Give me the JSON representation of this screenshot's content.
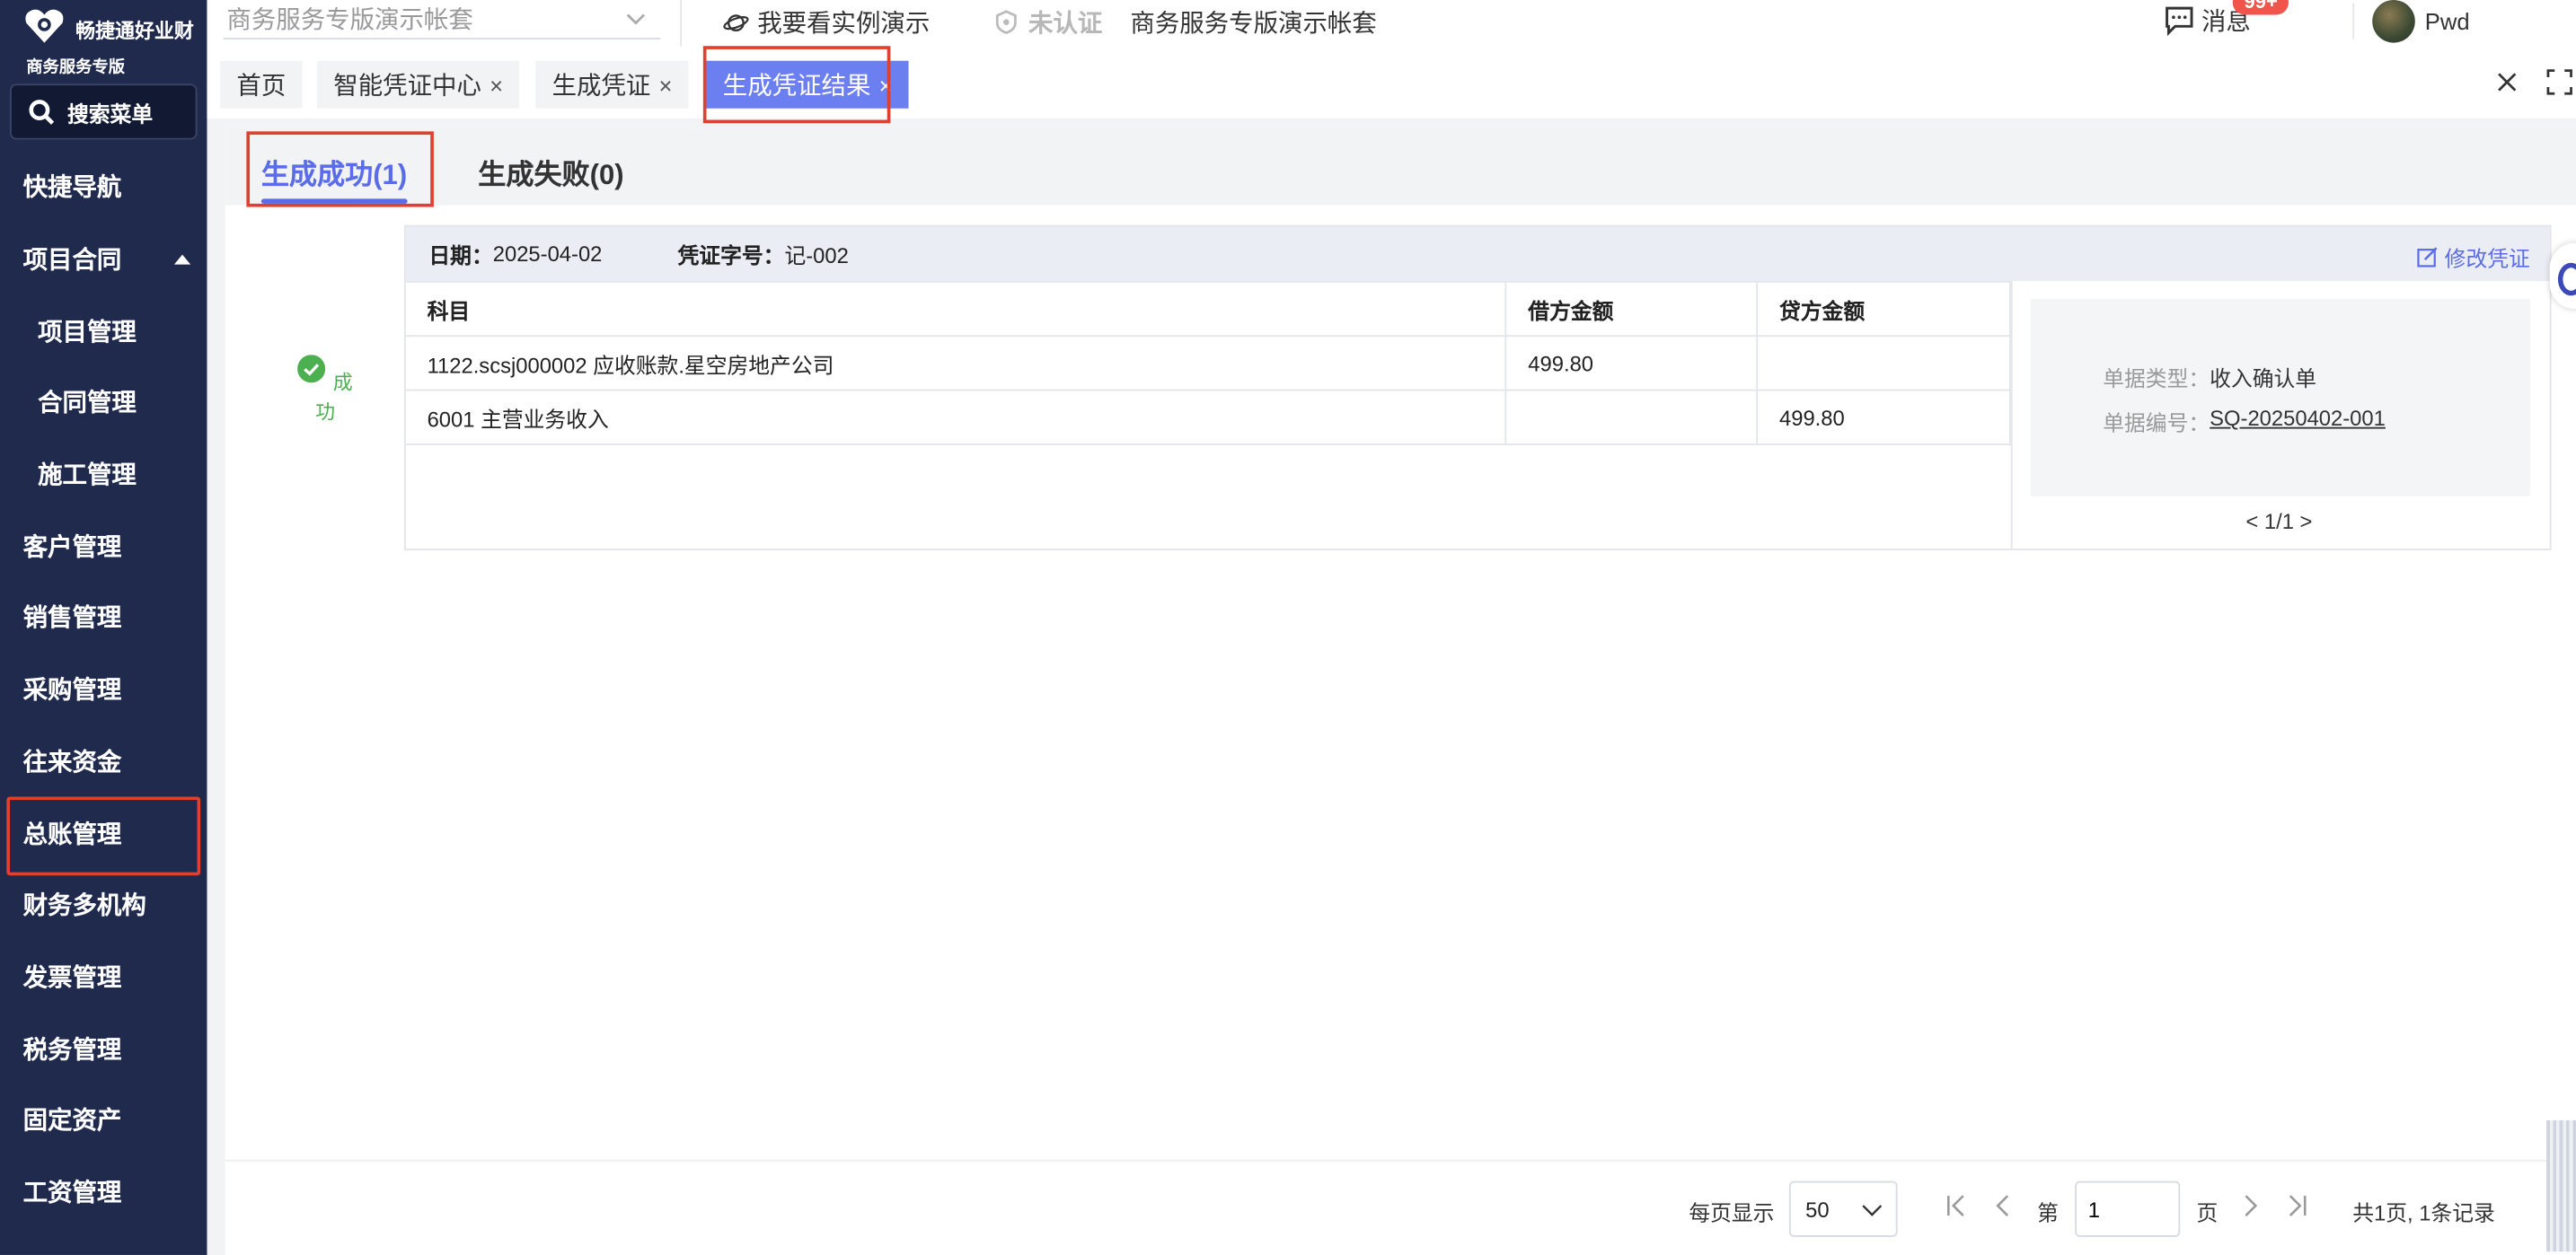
{
  "sidebar": {
    "logo_name": "畅捷通好业财",
    "logo_sub": "商务服务专版",
    "search_label": "搜索菜单",
    "items": [
      {
        "label": "快捷导航"
      },
      {
        "label": "项目合同"
      },
      {
        "label": "项目管理"
      },
      {
        "label": "合同管理"
      },
      {
        "label": "施工管理"
      },
      {
        "label": "客户管理"
      },
      {
        "label": "销售管理"
      },
      {
        "label": "采购管理"
      },
      {
        "label": "往来资金"
      },
      {
        "label": "总账管理"
      },
      {
        "label": "财务多机构"
      },
      {
        "label": "发票管理"
      },
      {
        "label": "税务管理"
      },
      {
        "label": "固定资产"
      },
      {
        "label": "工资管理"
      }
    ]
  },
  "topbar": {
    "account_select": "商务服务专版演示帐套",
    "demo_link": "我要看实例演示",
    "unverified": "未认证",
    "account_name": "商务服务专版演示帐套",
    "messages": "消息",
    "badge": "99+",
    "user": "Pwd"
  },
  "tabs": [
    {
      "label": "首页",
      "closable": false
    },
    {
      "label": "智能凭证中心",
      "closable": true
    },
    {
      "label": "生成凭证",
      "closable": true
    },
    {
      "label": "生成凭证结果",
      "closable": true,
      "active": true
    }
  ],
  "close_glyph": "×",
  "subtabs": {
    "success": "生成成功(1)",
    "failed": "生成失败(0)"
  },
  "result": {
    "status": "成功",
    "date_label": "日期：",
    "date": "2025-04-02",
    "voucher_no_label": "凭证字号：",
    "voucher_no": "记-002",
    "edit": "修改凭证",
    "headers": {
      "subject": "科目",
      "debit": "借方金额",
      "credit": "贷方金额"
    },
    "rows": [
      {
        "subject": "1122.scsj000002 应收账款.星空房地产公司",
        "debit": "499.80",
        "credit": ""
      },
      {
        "subject": "6001 主营业务收入",
        "debit": "",
        "credit": "499.80"
      }
    ],
    "doc_type_label": "单据类型：",
    "doc_type": "收入确认单",
    "doc_no_label": "单据编号：",
    "doc_no": "SQ-20250402-001",
    "mini_pager": "< 1/1 >"
  },
  "pager": {
    "per_page_label": "每页显示",
    "per_page": "50",
    "page_prefix": "第",
    "page": "1",
    "page_suffix": "页",
    "total": "共1页, 1条记录"
  },
  "colors": {
    "sidebar_bg": "#1f2a4d",
    "accent": "#5b6ce8",
    "active_tab": "#6c7ff0",
    "success": "#4caf50",
    "highlight": "#e0402f"
  }
}
